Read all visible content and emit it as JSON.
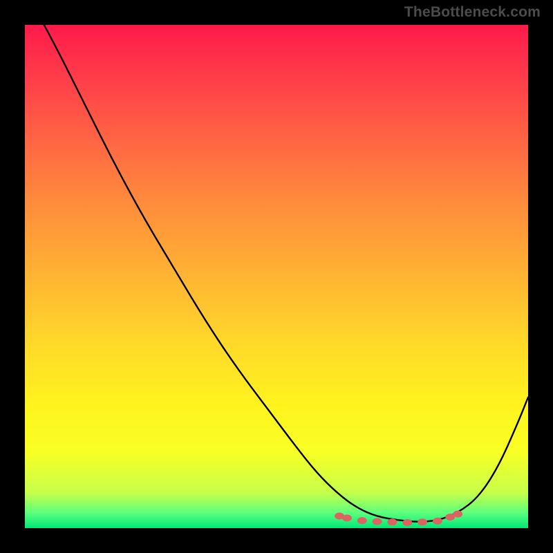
{
  "watermark": "TheBottleneck.com",
  "colors": {
    "background": "#000000",
    "watermark_text": "#4b4b4b",
    "curve": "#000000",
    "points": "#dd6363",
    "gradient_top": "#ff1a4b",
    "gradient_bottom": "#00e877"
  },
  "chart_data": {
    "type": "line",
    "title": "",
    "xlabel": "",
    "ylabel": "",
    "xlim": [
      0,
      100
    ],
    "ylim": [
      0,
      100
    ],
    "grid": false,
    "legend": null,
    "annotations": [],
    "series": [
      {
        "name": "bottleneck-curve",
        "x": [
          0,
          6,
          12,
          18,
          24,
          30,
          36,
          42,
          48,
          54,
          58,
          62,
          66,
          70,
          74,
          78,
          82,
          86,
          90,
          94,
          98,
          100
        ],
        "values": [
          107,
          96,
          84,
          72,
          61,
          51,
          41,
          32,
          24,
          16,
          11,
          7,
          4,
          2.3,
          1.6,
          1.2,
          1.5,
          3,
          6,
          12,
          21,
          26
        ]
      }
    ],
    "notes": "Axes are unlabeled in the source image; x/y are normalized 0–100. ylim top ≈100 maps to red, 0 maps to green. Minimum (bottleneck sweet spot) around x≈78."
  },
  "points": [
    {
      "x": 62.5,
      "y": 97.6
    },
    {
      "x": 64.0,
      "y": 98.0
    },
    {
      "x": 67.0,
      "y": 98.5
    },
    {
      "x": 70.0,
      "y": 98.7
    },
    {
      "x": 73.0,
      "y": 98.8
    },
    {
      "x": 76.0,
      "y": 98.9
    },
    {
      "x": 79.0,
      "y": 98.8
    },
    {
      "x": 82.0,
      "y": 98.6
    },
    {
      "x": 84.5,
      "y": 97.8
    },
    {
      "x": 86.0,
      "y": 97.2
    }
  ]
}
